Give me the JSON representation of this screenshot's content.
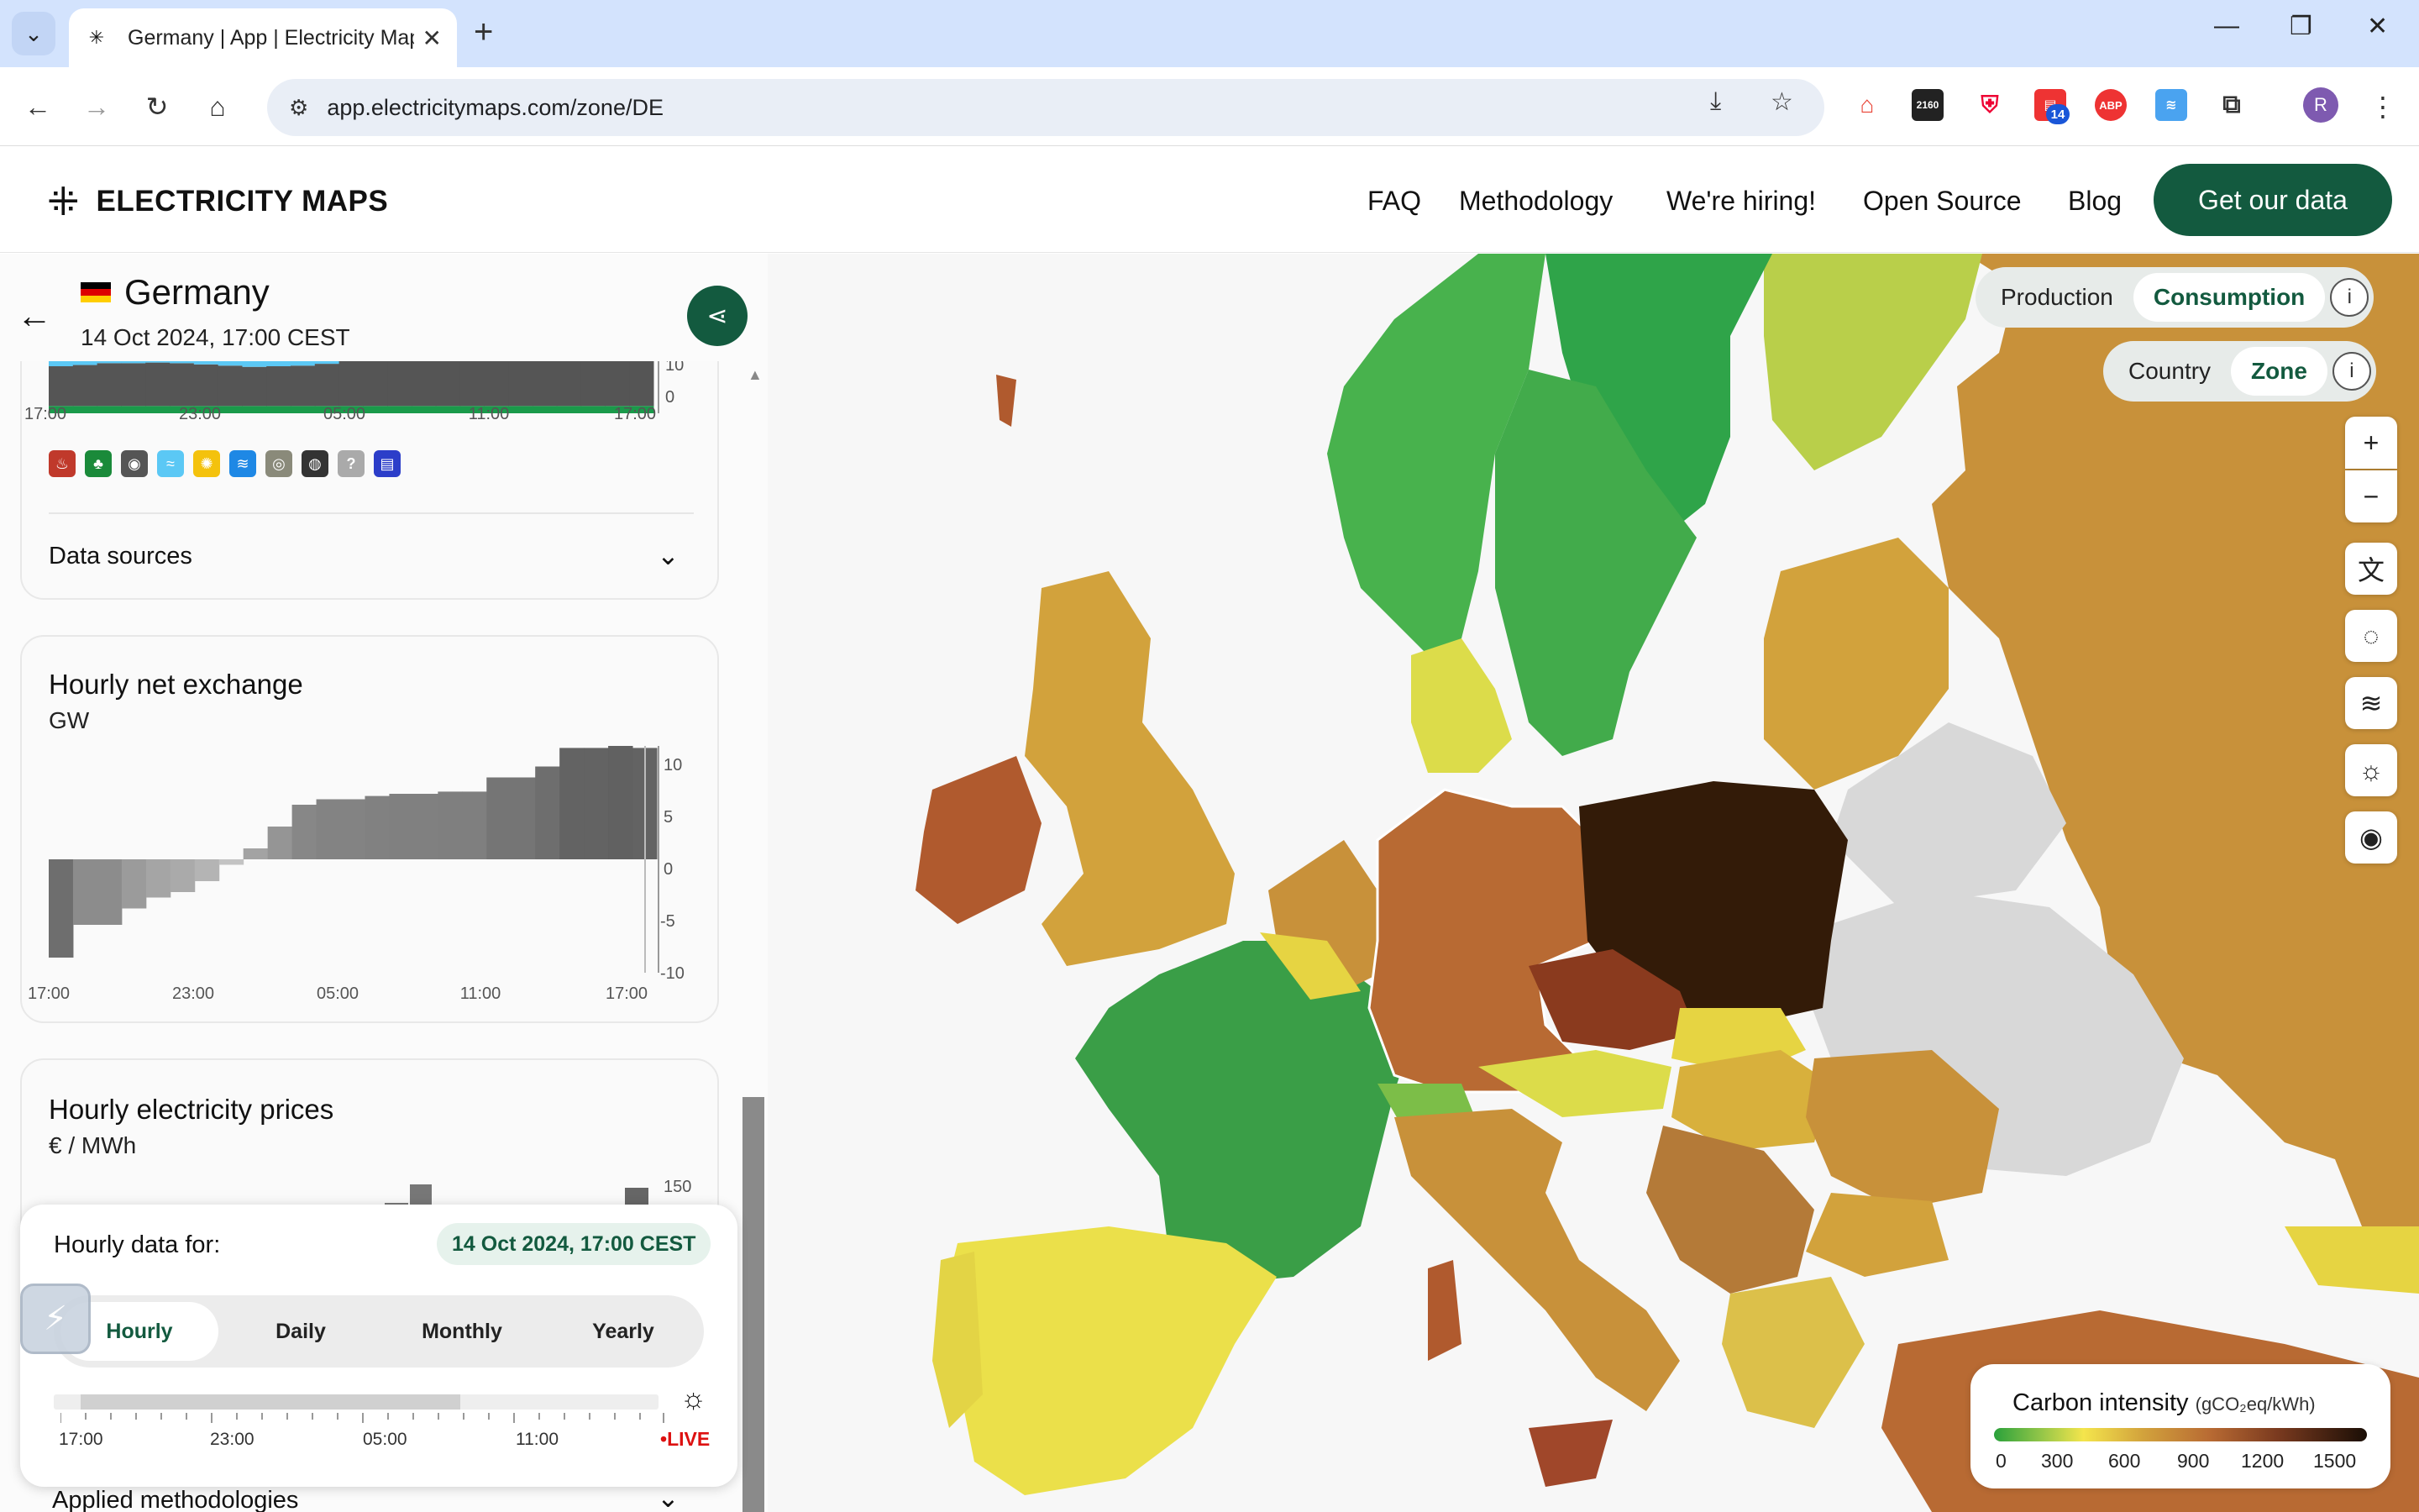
{
  "browser": {
    "tab_title": "Germany | App | Electricity Map",
    "url": "app.electricitymaps.com/zone/DE",
    "ext_badge": "14",
    "ext_2160": "2160",
    "ext_abp": "ABP",
    "avatar_letter": "R"
  },
  "header": {
    "brand": "ELECTRICITY MAPS",
    "nav": [
      "FAQ",
      "Methodology",
      "We're hiring!",
      "Open Source",
      "Blog"
    ],
    "cta": "Get our data"
  },
  "zone": {
    "name": "Germany",
    "datetime": "14 Oct 2024, 17:00 CEST"
  },
  "breakdown_card": {
    "y_ticks": [
      "10",
      "0"
    ],
    "x_ticks": [
      "17:00",
      "23:00",
      "05:00",
      "11:00",
      "17:00"
    ],
    "legend_icons": [
      "biomass-icon",
      "geothermal-icon",
      "coal-icon",
      "wind-icon",
      "solar-icon",
      "hydro-icon",
      "nuclear-icon",
      "oil-icon",
      "unknown-icon",
      "battery-icon"
    ],
    "unknown_symbol": "?",
    "data_sources_label": "Data sources"
  },
  "exchange_card": {
    "title": "Hourly net exchange",
    "unit": "GW",
    "y_ticks": [
      "10",
      "5",
      "0",
      "-5",
      "-10"
    ],
    "x_ticks": [
      "17:00",
      "23:00",
      "05:00",
      "11:00",
      "17:00"
    ]
  },
  "price_card": {
    "title": "Hourly electricity prices",
    "unit": "€ / MWh",
    "y_tick": "150"
  },
  "time_controller": {
    "label": "Hourly data for:",
    "date": "14 Oct 2024, 17:00 CEST",
    "tabs": [
      "Hourly",
      "Daily",
      "Monthly",
      "Yearly"
    ],
    "active_tab": "Hourly",
    "ticks": [
      "17:00",
      "23:00",
      "05:00",
      "11:00"
    ],
    "live_label": "LIVE"
  },
  "applied_methodologies": "Applied methodologies",
  "map": {
    "mode_toggle": [
      "Production",
      "Consumption"
    ],
    "mode_active": "Consumption",
    "scope_toggle": [
      "Country",
      "Zone"
    ],
    "scope_active": "Zone",
    "controls": [
      "zoom-in",
      "zoom-out",
      "language",
      "hide-colorblind",
      "wind-layer",
      "solar-layer",
      "color-palette"
    ]
  },
  "ci_legend": {
    "title": "Carbon intensity",
    "unit": "(gCO₂eq/kWh)",
    "ticks": [
      "0",
      "300",
      "600",
      "900",
      "1200",
      "1500"
    ]
  },
  "chart_data": [
    {
      "type": "area",
      "x_ticks": [
        "17:00",
        "23:00",
        "05:00",
        "11:00",
        "17:00"
      ],
      "y_ticks": [
        0,
        10
      ],
      "note_colors": {
        "solar": "#5bc8f5",
        "fossil": "#555555",
        "renewable": "#1a9a4a"
      },
      "series": [
        {
          "values": [
            1.2,
            1.2,
            1.2,
            1.2,
            1.2,
            1.2,
            1.2,
            1.2,
            1.2,
            1.2,
            1.2,
            1.2,
            1.2,
            1.2,
            1.2,
            1.2,
            1.2,
            1.2,
            1.2,
            1.2,
            1.2,
            1.2,
            1.2,
            1.2,
            1.2
          ]
        },
        {
          "values": [
            6.5,
            6.7,
            7.0,
            7.0,
            7.1,
            7.0,
            6.8,
            6.6,
            6.4,
            6.5,
            6.6,
            6.9,
            9.6,
            9.6,
            9.6,
            9.6,
            9.6,
            9.6,
            9.6,
            9.6,
            9.6,
            9.6,
            9.6,
            9.6,
            9.6
          ]
        },
        {
          "values": [
            2.5,
            2.3,
            2.0,
            2.0,
            1.9,
            2.0,
            2.2,
            2.4,
            2.6,
            2.5,
            2.4,
            2.1,
            0,
            0,
            0,
            0,
            0,
            0,
            0,
            0,
            0,
            0,
            0,
            0,
            0
          ]
        }
      ]
    },
    {
      "type": "bar",
      "title": "Hourly net exchange",
      "ylabel": "GW",
      "ylim": [
        -10,
        10
      ],
      "x_ticks": [
        "17:00",
        "23:00",
        "05:00",
        "11:00",
        "17:00"
      ],
      "values": [
        -9,
        -6,
        -6,
        -4.5,
        -3.5,
        -3,
        -2,
        -0.5,
        1,
        3,
        5,
        5.5,
        5.5,
        5.8,
        6,
        6,
        6.2,
        6.2,
        7.5,
        7.5,
        8.5,
        10.2,
        10.2,
        10.4,
        10.2
      ]
    }
  ]
}
